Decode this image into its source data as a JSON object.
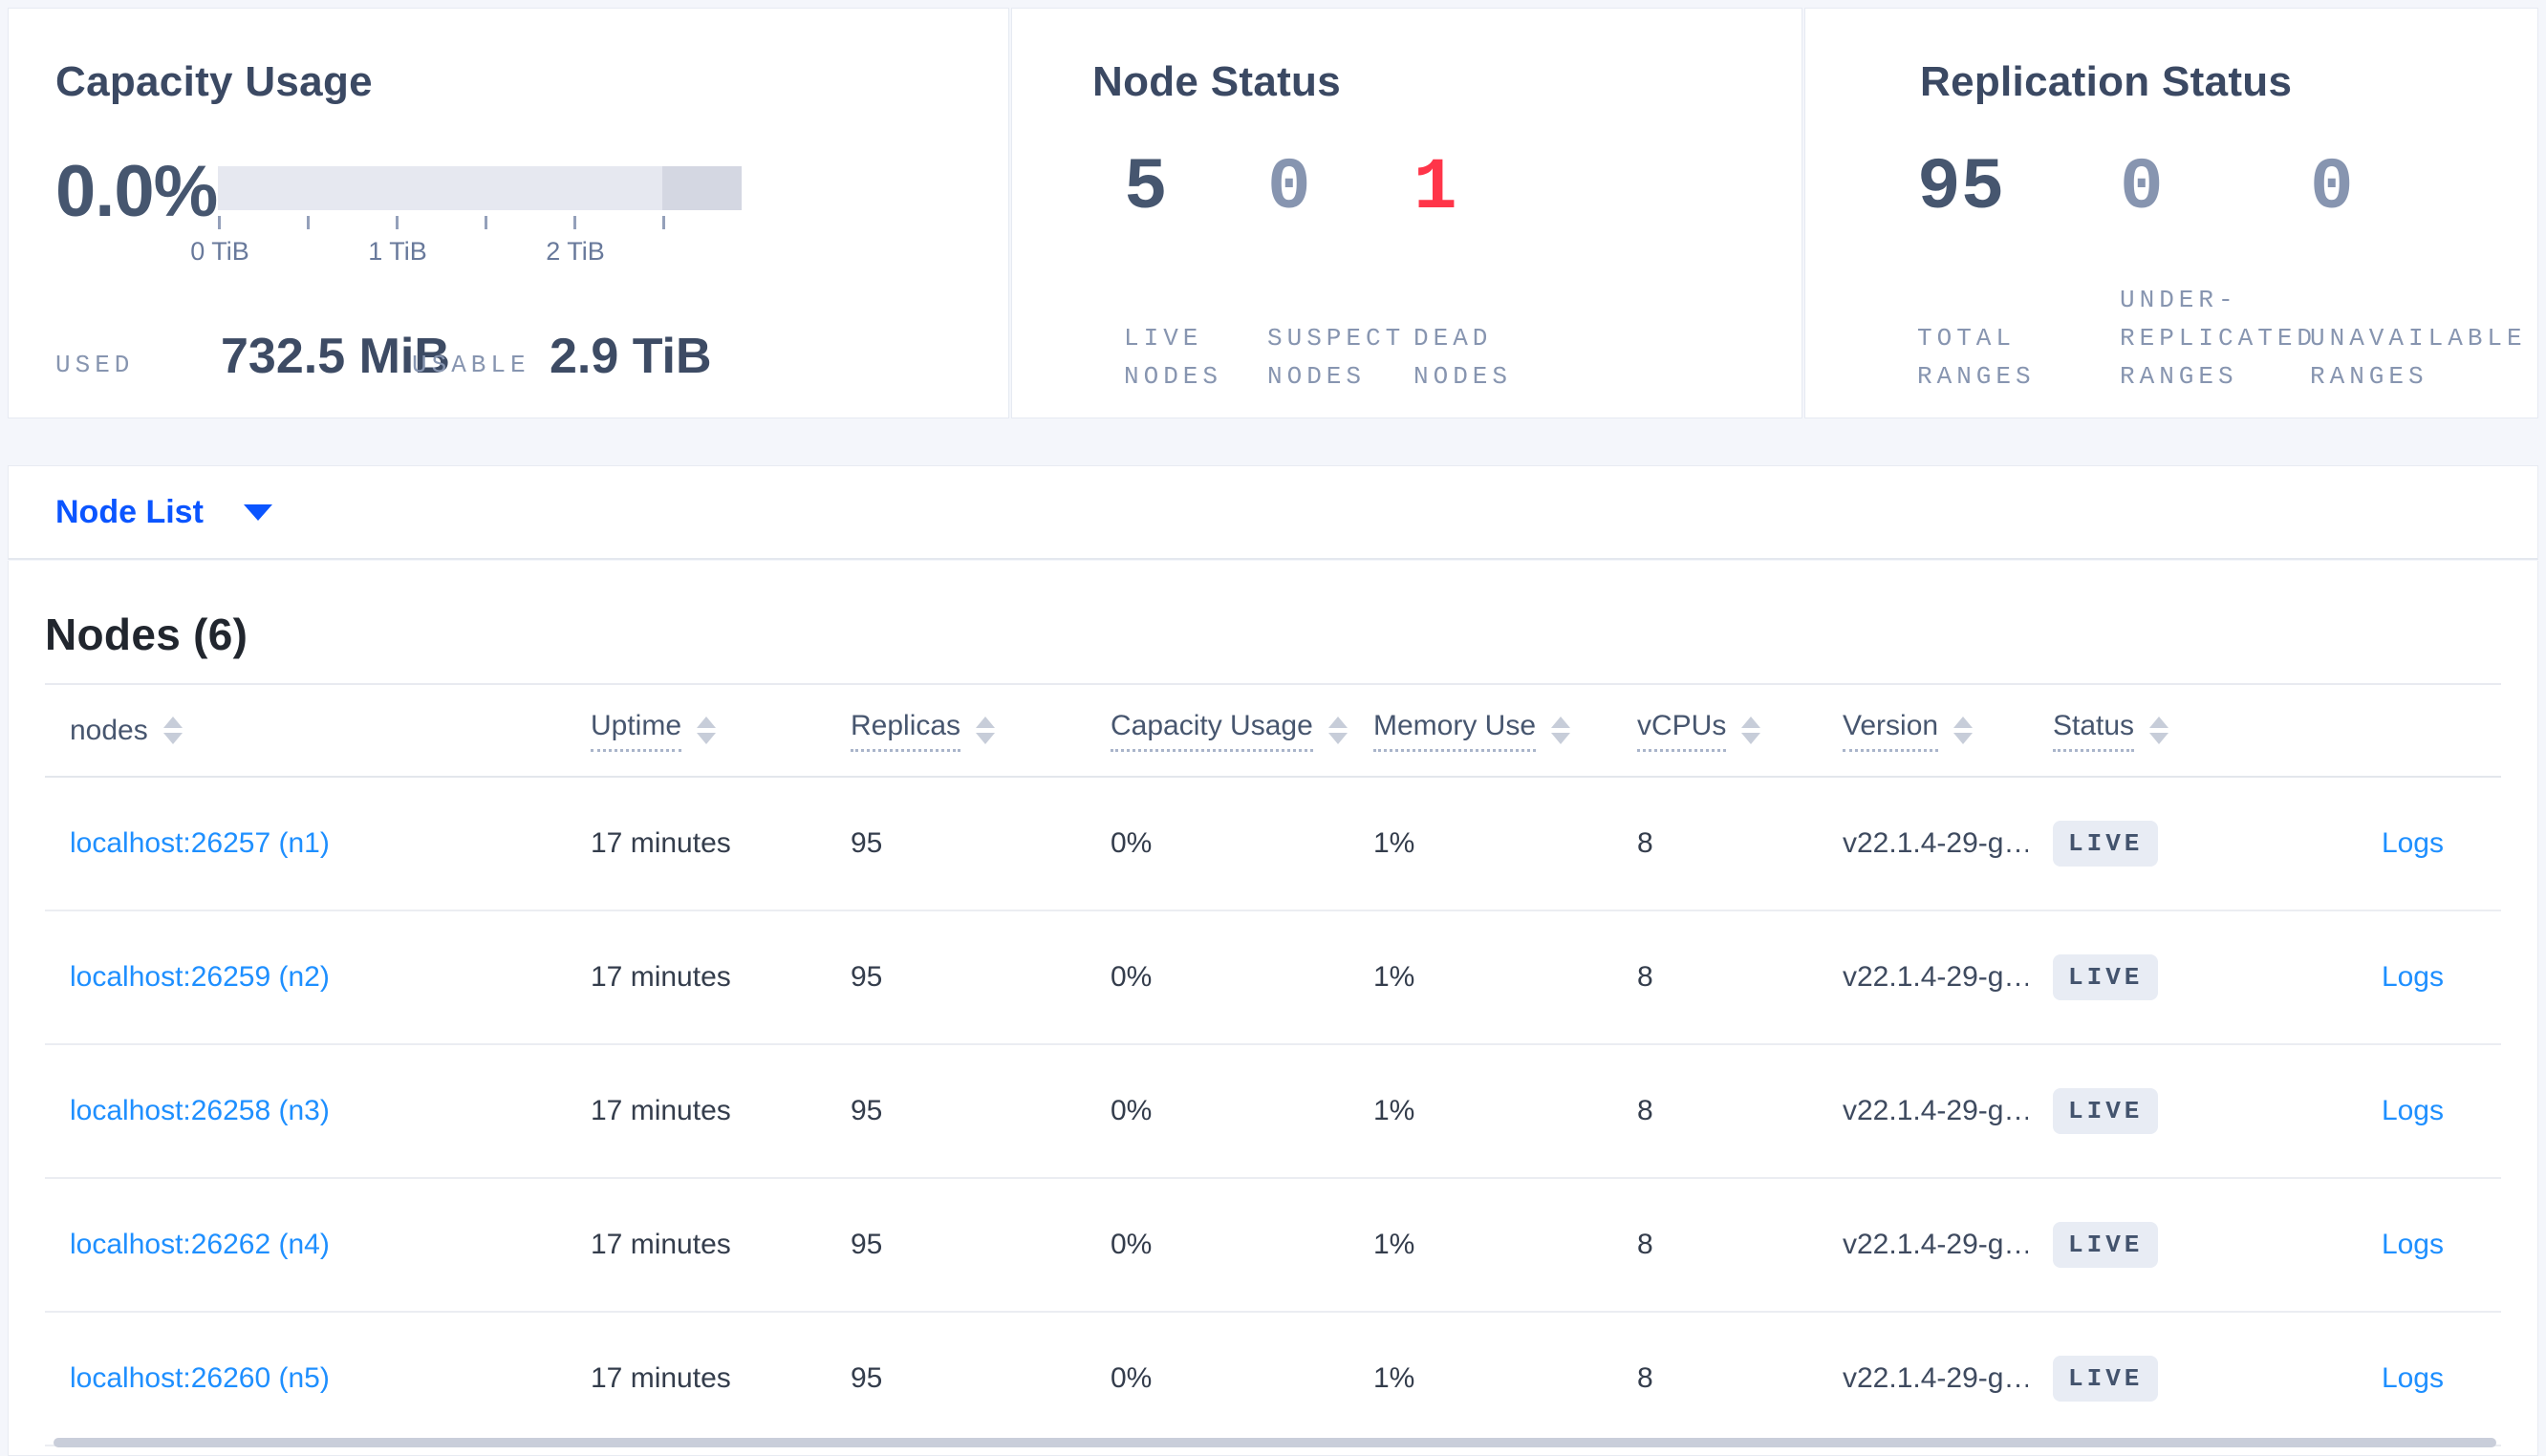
{
  "capacity_usage": {
    "title": "Capacity Usage",
    "percent": "0.0%",
    "tick_labels": [
      "0 TiB",
      "1 TiB",
      "2 TiB"
    ],
    "used_label": "USED",
    "used_value": "732.5 MiB",
    "usable_label": "USABLE",
    "usable_value": "2.9 TiB",
    "bar_track_color": "#e6e8f0",
    "bar_reserved_color": "#d4d7e2"
  },
  "node_status": {
    "title": "Node Status",
    "stats": [
      {
        "value": "5",
        "label": "LIVE\nNODES",
        "color": "#46566f"
      },
      {
        "value": "0",
        "label": "SUSPECT\nNODES",
        "color": "#8795b0"
      },
      {
        "value": "1",
        "label": "DEAD\nNODES",
        "color": "#ff3549"
      }
    ]
  },
  "replication_status": {
    "title": "Replication Status",
    "stats": [
      {
        "value": "95",
        "label": "TOTAL\nRANGES",
        "color": "#46566f"
      },
      {
        "value": "0",
        "label": "UNDER-\nREPLICATED\nRANGES",
        "color": "#8795b0"
      },
      {
        "value": "0",
        "label": "UNAVAILABLE\nRANGES",
        "color": "#8795b0"
      }
    ]
  },
  "node_list": {
    "label": "Node List"
  },
  "nodes_table": {
    "title": "Nodes (6)",
    "columns": [
      "nodes",
      "Uptime",
      "Replicas",
      "Capacity Usage",
      "Memory Use",
      "vCPUs",
      "Version",
      "Status"
    ],
    "rows": [
      {
        "node": "localhost:26257 (n1)",
        "uptime": "17 minutes",
        "replicas": "95",
        "capacity": "0%",
        "memory": "1%",
        "vcpus": "8",
        "version": "v22.1.4-29-g…",
        "status": "LIVE",
        "logs": "Logs"
      },
      {
        "node": "localhost:26259 (n2)",
        "uptime": "17 minutes",
        "replicas": "95",
        "capacity": "0%",
        "memory": "1%",
        "vcpus": "8",
        "version": "v22.1.4-29-g…",
        "status": "LIVE",
        "logs": "Logs"
      },
      {
        "node": "localhost:26258 (n3)",
        "uptime": "17 minutes",
        "replicas": "95",
        "capacity": "0%",
        "memory": "1%",
        "vcpus": "8",
        "version": "v22.1.4-29-g…",
        "status": "LIVE",
        "logs": "Logs"
      },
      {
        "node": "localhost:26262 (n4)",
        "uptime": "17 minutes",
        "replicas": "95",
        "capacity": "0%",
        "memory": "1%",
        "vcpus": "8",
        "version": "v22.1.4-29-g…",
        "status": "LIVE",
        "logs": "Logs"
      },
      {
        "node": "localhost:26260 (n5)",
        "uptime": "17 minutes",
        "replicas": "95",
        "capacity": "0%",
        "memory": "1%",
        "vcpus": "8",
        "version": "v22.1.4-29-g…",
        "status": "LIVE",
        "logs": "Logs"
      }
    ]
  }
}
